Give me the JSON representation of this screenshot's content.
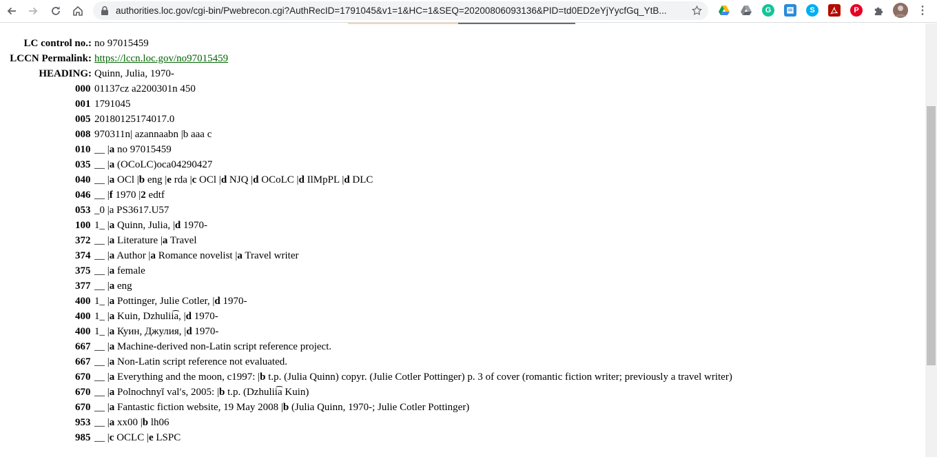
{
  "browser": {
    "url": "authorities.loc.gov/cgi-bin/Pwebrecon.cgi?AuthRecID=1791045&v1=1&HC=1&SEQ=20200806093136&PID=td0ED2eYjYycfGq_YtB..."
  },
  "record": {
    "header": [
      {
        "label": "LC control no.:",
        "value": "no 97015459"
      },
      {
        "label": "LCCN Permalink:",
        "value": "https://lccn.loc.gov/no97015459",
        "link": true
      },
      {
        "label": "HEADING:",
        "value": "Quinn, Julia, 1970-"
      }
    ],
    "fields": [
      {
        "tag": "000",
        "parts": [
          {
            "t": "01137cz a2200301n 450"
          }
        ]
      },
      {
        "tag": "001",
        "parts": [
          {
            "t": "1791045"
          }
        ]
      },
      {
        "tag": "005",
        "parts": [
          {
            "t": "20180125174017.0"
          }
        ]
      },
      {
        "tag": "008",
        "parts": [
          {
            "t": "970311n| azannaabn |b aaa c"
          }
        ]
      },
      {
        "tag": "010",
        "parts": [
          {
            "t": "__ |"
          },
          {
            "b": "a"
          },
          {
            "t": " no 97015459"
          }
        ]
      },
      {
        "tag": "035",
        "parts": [
          {
            "t": "__ |"
          },
          {
            "b": "a"
          },
          {
            "t": " (OCoLC)oca04290427"
          }
        ]
      },
      {
        "tag": "040",
        "parts": [
          {
            "t": "__ |"
          },
          {
            "b": "a"
          },
          {
            "t": " OCl |"
          },
          {
            "b": "b"
          },
          {
            "t": " eng |"
          },
          {
            "b": "e"
          },
          {
            "t": " rda |"
          },
          {
            "b": "c"
          },
          {
            "t": " OCl |"
          },
          {
            "b": "d"
          },
          {
            "t": " NJQ |"
          },
          {
            "b": "d"
          },
          {
            "t": " OCoLC |"
          },
          {
            "b": "d"
          },
          {
            "t": " IlMpPL |"
          },
          {
            "b": "d"
          },
          {
            "t": " DLC"
          }
        ]
      },
      {
        "tag": "046",
        "parts": [
          {
            "t": "__ |"
          },
          {
            "b": "f"
          },
          {
            "t": " 1970 |"
          },
          {
            "b": "2"
          },
          {
            "t": " edtf"
          }
        ]
      },
      {
        "tag": "053",
        "parts": [
          {
            "t": "_0 |a PS3617.U57"
          }
        ]
      },
      {
        "tag": "100",
        "parts": [
          {
            "t": "1_ |"
          },
          {
            "b": "a"
          },
          {
            "t": " Quinn, Julia, |"
          },
          {
            "b": "d"
          },
          {
            "t": " 1970-"
          }
        ]
      },
      {
        "tag": "372",
        "parts": [
          {
            "t": "__ |"
          },
          {
            "b": "a"
          },
          {
            "t": " Literature |"
          },
          {
            "b": "a"
          },
          {
            "t": " Travel"
          }
        ]
      },
      {
        "tag": "374",
        "parts": [
          {
            "t": "__ |"
          },
          {
            "b": "a"
          },
          {
            "t": " Author |"
          },
          {
            "b": "a"
          },
          {
            "t": " Romance novelist |"
          },
          {
            "b": "a"
          },
          {
            "t": " Travel writer"
          }
        ]
      },
      {
        "tag": "375",
        "parts": [
          {
            "t": "__ |"
          },
          {
            "b": "a"
          },
          {
            "t": " female"
          }
        ]
      },
      {
        "tag": "377",
        "parts": [
          {
            "t": "__ |"
          },
          {
            "b": "a"
          },
          {
            "t": " eng"
          }
        ]
      },
      {
        "tag": "400",
        "parts": [
          {
            "t": "1_ |"
          },
          {
            "b": "a"
          },
          {
            "t": " Pottinger, Julie Cotler, |"
          },
          {
            "b": "d"
          },
          {
            "t": " 1970-"
          }
        ]
      },
      {
        "tag": "400",
        "parts": [
          {
            "t": "1_ |"
          },
          {
            "b": "a"
          },
          {
            "t": " Kuin, Dzhulii͡a, |"
          },
          {
            "b": "d"
          },
          {
            "t": " 1970-"
          }
        ]
      },
      {
        "tag": "400",
        "parts": [
          {
            "t": "1_ |"
          },
          {
            "b": "a"
          },
          {
            "t": " Куин, Джулия, |"
          },
          {
            "b": "d"
          },
          {
            "t": " 1970-"
          }
        ]
      },
      {
        "tag": "667",
        "parts": [
          {
            "t": "__ |"
          },
          {
            "b": "a"
          },
          {
            "t": " Machine-derived non-Latin script reference project."
          }
        ]
      },
      {
        "tag": "667",
        "parts": [
          {
            "t": "__ |"
          },
          {
            "b": "a"
          },
          {
            "t": " Non-Latin script reference not evaluated."
          }
        ]
      },
      {
        "tag": "670",
        "parts": [
          {
            "t": "__ |"
          },
          {
            "b": "a"
          },
          {
            "t": " Everything and the moon, c1997: |"
          },
          {
            "b": "b"
          },
          {
            "t": " t.p. (Julia Quinn) copyr. (Julie Cotler Pottinger) p. 3 of cover (romantic fiction writer; previously a travel writer)"
          }
        ]
      },
      {
        "tag": "670",
        "parts": [
          {
            "t": "__ |"
          },
          {
            "b": "a"
          },
          {
            "t": " Polnochnyĭ valʹs, 2005: |"
          },
          {
            "b": "b"
          },
          {
            "t": " t.p. (Dzhulii͡a Kuin)"
          }
        ]
      },
      {
        "tag": "670",
        "parts": [
          {
            "t": "__ |"
          },
          {
            "b": "a"
          },
          {
            "t": " Fantastic fiction website, 19 May 2008 |"
          },
          {
            "b": "b"
          },
          {
            "t": " (Julia Quinn, 1970-; Julie Cotler Pottinger)"
          }
        ]
      },
      {
        "tag": "953",
        "parts": [
          {
            "t": "__ |"
          },
          {
            "b": "a"
          },
          {
            "t": " xx00 |"
          },
          {
            "b": "b"
          },
          {
            "t": " lh06"
          }
        ]
      },
      {
        "tag": "985",
        "parts": [
          {
            "t": "__ |"
          },
          {
            "b": "c"
          },
          {
            "t": " OCLC |"
          },
          {
            "b": "e"
          },
          {
            "t": " LSPC"
          }
        ]
      }
    ]
  }
}
